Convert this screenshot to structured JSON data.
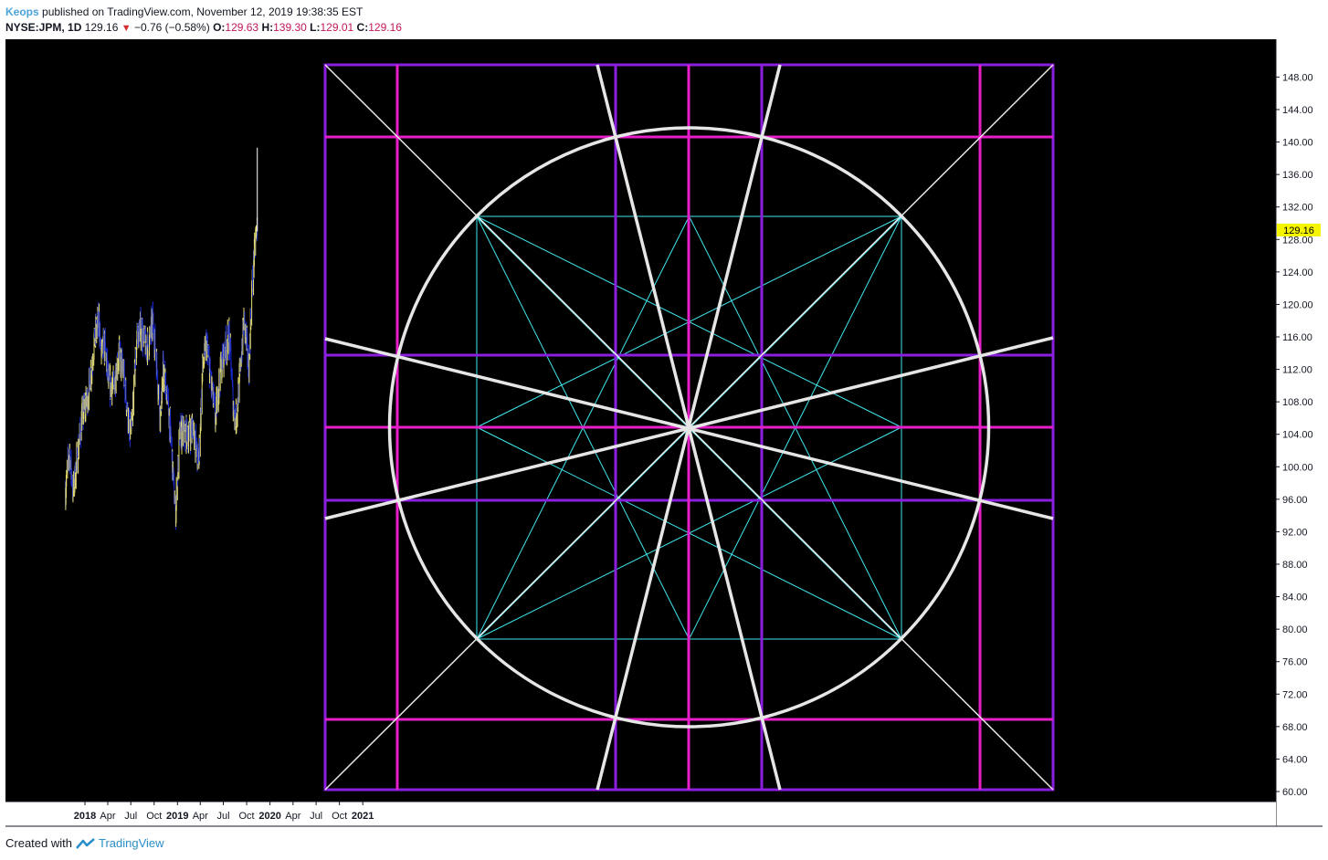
{
  "header": {
    "author": "Keops",
    "published_text": "published on TradingView.com, November 12, 2019 19:38:35 EST",
    "symbol": "NYSE:JPM, 1D",
    "last": "129.16",
    "change": "−0.76 (−0.58%)",
    "o_label": "O:",
    "o_value": "129.63",
    "h_label": "H:",
    "h_value": "139.30",
    "l_label": "L:",
    "l_value": "129.01",
    "c_label": "C:",
    "c_value": "129.16"
  },
  "footer": {
    "created_with": "Created with",
    "brand": "TradingView"
  },
  "colors": {
    "background": "#000000",
    "purple": "#8b1fe0",
    "magenta": "#e61ec8",
    "white_geometry": "#e6e6e6",
    "cyan": "#40e8f0",
    "candle_up": "#e8e070",
    "candle_down": "#1a2ad0",
    "last_price_badge": "#f5f500"
  },
  "chart_data": {
    "type": "candlestick",
    "symbol": "NYSE:JPM",
    "interval": "1D",
    "last_price": 129.16,
    "last_price_label": "129.16",
    "ylim": [
      60,
      148
    ],
    "y_ticks": [
      "148.00",
      "144.00",
      "140.00",
      "136.00",
      "132.00",
      "128.00",
      "124.00",
      "120.00",
      "116.00",
      "112.00",
      "108.00",
      "104.00",
      "100.00",
      "96.00",
      "92.00",
      "88.00",
      "84.00",
      "80.00",
      "76.00",
      "72.00",
      "68.00",
      "64.00",
      "60.00"
    ],
    "x_ticks": [
      {
        "label": "2018",
        "bold": true,
        "date": "2018-01-01"
      },
      {
        "label": "Apr",
        "bold": false,
        "date": "2018-04-01"
      },
      {
        "label": "Jul",
        "bold": false,
        "date": "2018-07-01"
      },
      {
        "label": "Oct",
        "bold": false,
        "date": "2018-10-01"
      },
      {
        "label": "2019",
        "bold": true,
        "date": "2019-01-01"
      },
      {
        "label": "Apr",
        "bold": false,
        "date": "2019-04-01"
      },
      {
        "label": "Jul",
        "bold": false,
        "date": "2019-07-01"
      },
      {
        "label": "Oct",
        "bold": false,
        "date": "2019-10-01"
      },
      {
        "label": "2020",
        "bold": true,
        "date": "2020-01-01"
      },
      {
        "label": "Apr",
        "bold": false,
        "date": "2020-04-01"
      },
      {
        "label": "Jul",
        "bold": false,
        "date": "2020-07-01"
      },
      {
        "label": "Oct",
        "bold": false,
        "date": "2020-10-01"
      },
      {
        "label": "2021",
        "bold": true,
        "date": "2021-01-01"
      }
    ],
    "price_path": [
      [
        "2017-10-16",
        97
      ],
      [
        "2017-11-01",
        102
      ],
      [
        "2017-11-15",
        97
      ],
      [
        "2017-12-01",
        101
      ],
      [
        "2017-12-20",
        106
      ],
      [
        "2018-01-15",
        109
      ],
      [
        "2018-02-09",
        116
      ],
      [
        "2018-02-26",
        118
      ],
      [
        "2018-03-05",
        114
      ],
      [
        "2018-03-20",
        115
      ],
      [
        "2018-04-05",
        110
      ],
      [
        "2018-04-25",
        110
      ],
      [
        "2018-05-15",
        114
      ],
      [
        "2018-06-05",
        111
      ],
      [
        "2018-06-25",
        104
      ],
      [
        "2018-07-05",
        105
      ],
      [
        "2018-07-25",
        116
      ],
      [
        "2018-08-10",
        117
      ],
      [
        "2018-08-25",
        115
      ],
      [
        "2018-09-10",
        115
      ],
      [
        "2018-09-25",
        118
      ],
      [
        "2018-10-05",
        115
      ],
      [
        "2018-10-26",
        106
      ],
      [
        "2018-11-05",
        112
      ],
      [
        "2018-11-20",
        109
      ],
      [
        "2018-12-05",
        104
      ],
      [
        "2018-12-24",
        94
      ],
      [
        "2019-01-10",
        104
      ],
      [
        "2019-01-25",
        104
      ],
      [
        "2019-02-15",
        104
      ],
      [
        "2019-03-05",
        105
      ],
      [
        "2019-03-25",
        100
      ],
      [
        "2019-04-10",
        112
      ],
      [
        "2019-04-25",
        115
      ],
      [
        "2019-05-15",
        110
      ],
      [
        "2019-05-31",
        106
      ],
      [
        "2019-06-20",
        112
      ],
      [
        "2019-07-10",
        115
      ],
      [
        "2019-07-25",
        116
      ],
      [
        "2019-08-10",
        107
      ],
      [
        "2019-08-20",
        106
      ],
      [
        "2019-09-01",
        110
      ],
      [
        "2019-09-20",
        118
      ],
      [
        "2019-10-01",
        115
      ],
      [
        "2019-10-10",
        112
      ],
      [
        "2019-10-20",
        121
      ],
      [
        "2019-10-31",
        126
      ],
      [
        "2019-11-08",
        129
      ],
      [
        "2019-11-12",
        129.16
      ]
    ]
  }
}
